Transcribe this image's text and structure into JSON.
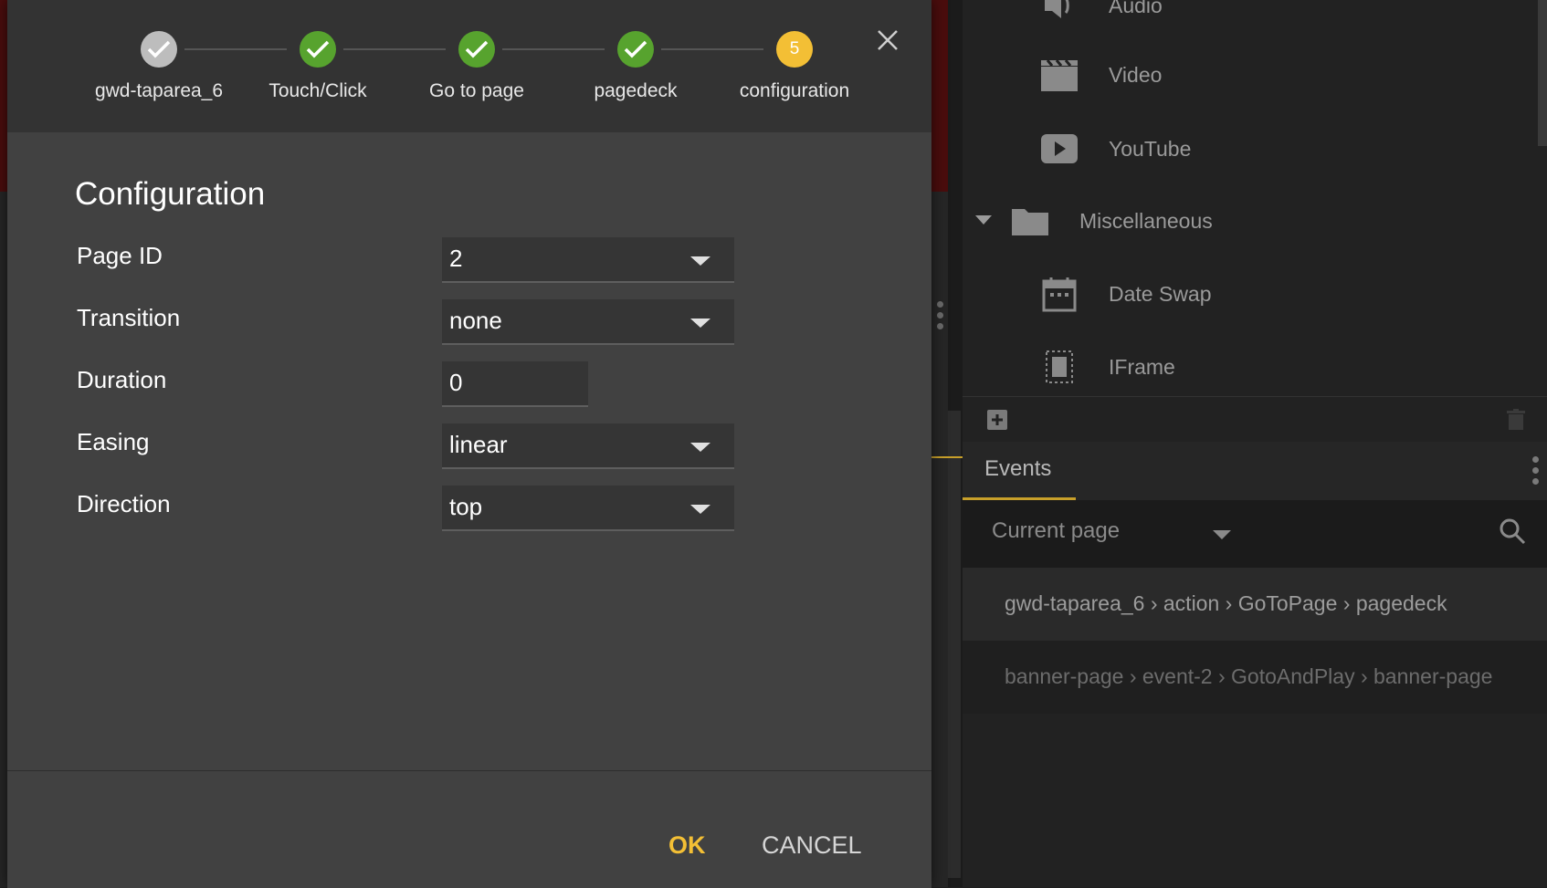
{
  "dialog": {
    "steps": [
      {
        "label": "gwd-taparea_6",
        "state": "done-first"
      },
      {
        "label": "Touch/Click",
        "state": "done"
      },
      {
        "label": "Go to page",
        "state": "done"
      },
      {
        "label": "pagedeck",
        "state": "done"
      },
      {
        "label": "configuration",
        "state": "active",
        "number": "5"
      }
    ],
    "title": "Configuration",
    "fields": {
      "page_id": {
        "label": "Page ID",
        "value": "2"
      },
      "transition": {
        "label": "Transition",
        "value": "none"
      },
      "duration": {
        "label": "Duration",
        "value": "0"
      },
      "easing": {
        "label": "Easing",
        "value": "linear"
      },
      "direction": {
        "label": "Direction",
        "value": "top"
      }
    },
    "ok_label": "OK",
    "cancel_label": "CANCEL",
    "colors": {
      "accent": "#f3bf35",
      "done": "#57a32e"
    }
  },
  "library": {
    "items": [
      {
        "label": "Audio",
        "icon": "speaker-icon"
      },
      {
        "label": "Video",
        "icon": "clapperboard-icon"
      },
      {
        "label": "YouTube",
        "icon": "play-icon"
      },
      {
        "label": "Miscellaneous",
        "icon": "folder-icon"
      },
      {
        "label": "Date Swap",
        "icon": "calendar-icon"
      },
      {
        "label": "IFrame",
        "icon": "iframe-icon"
      }
    ]
  },
  "events": {
    "tab_label": "Events",
    "filter_label": "Current page",
    "rows": [
      "gwd-taparea_6 › action › GoToPage › pagedeck",
      "banner-page › event-2 › GotoAndPlay › banner-page"
    ]
  }
}
